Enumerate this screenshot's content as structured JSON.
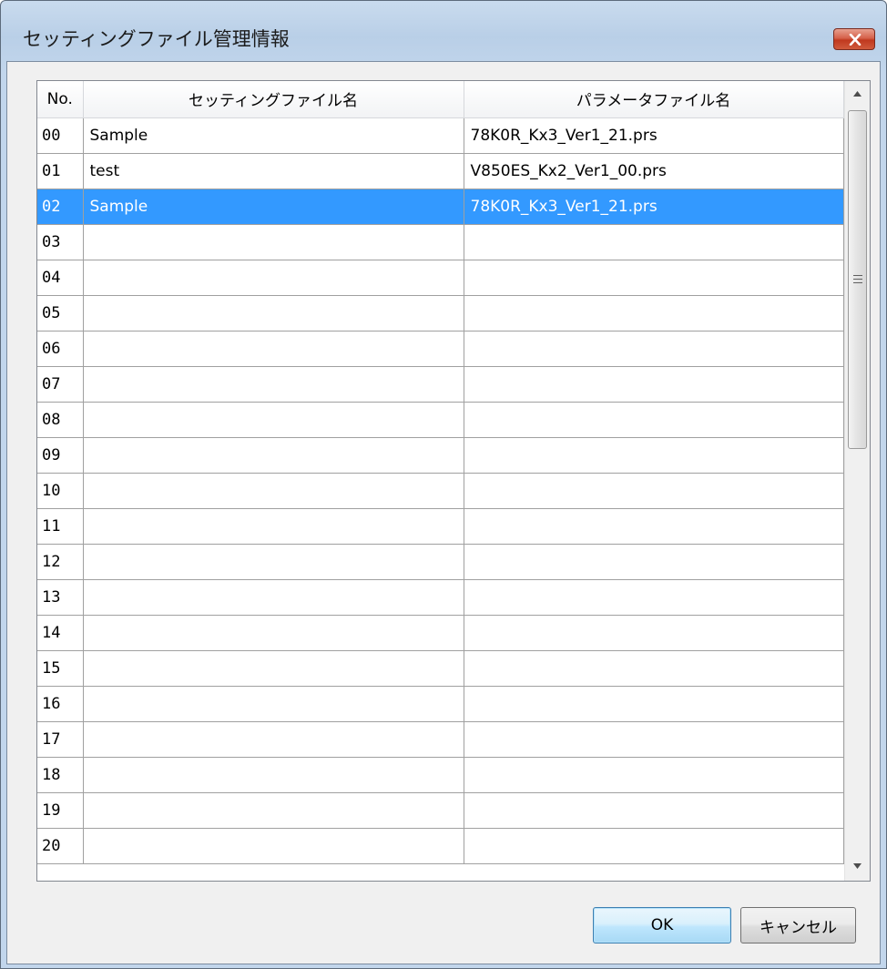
{
  "window": {
    "title": "セッティングファイル管理情報"
  },
  "table": {
    "headers": {
      "no": "No.",
      "setting_file": "セッティングファイル名",
      "param_file": "パラメータファイル名"
    },
    "rows": [
      {
        "no": "00",
        "setting": "Sample",
        "param": "78K0R_Kx3_Ver1_21.prs",
        "selected": false
      },
      {
        "no": "01",
        "setting": "test",
        "param": "V850ES_Kx2_Ver1_00.prs",
        "selected": false
      },
      {
        "no": "02",
        "setting": "Sample",
        "param": "78K0R_Kx3_Ver1_21.prs",
        "selected": true
      },
      {
        "no": "03",
        "setting": "",
        "param": "",
        "selected": false
      },
      {
        "no": "04",
        "setting": "",
        "param": "",
        "selected": false
      },
      {
        "no": "05",
        "setting": "",
        "param": "",
        "selected": false
      },
      {
        "no": "06",
        "setting": "",
        "param": "",
        "selected": false
      },
      {
        "no": "07",
        "setting": "",
        "param": "",
        "selected": false
      },
      {
        "no": "08",
        "setting": "",
        "param": "",
        "selected": false
      },
      {
        "no": "09",
        "setting": "",
        "param": "",
        "selected": false
      },
      {
        "no": "10",
        "setting": "",
        "param": "",
        "selected": false
      },
      {
        "no": "11",
        "setting": "",
        "param": "",
        "selected": false
      },
      {
        "no": "12",
        "setting": "",
        "param": "",
        "selected": false
      },
      {
        "no": "13",
        "setting": "",
        "param": "",
        "selected": false
      },
      {
        "no": "14",
        "setting": "",
        "param": "",
        "selected": false
      },
      {
        "no": "15",
        "setting": "",
        "param": "",
        "selected": false
      },
      {
        "no": "16",
        "setting": "",
        "param": "",
        "selected": false
      },
      {
        "no": "17",
        "setting": "",
        "param": "",
        "selected": false
      },
      {
        "no": "18",
        "setting": "",
        "param": "",
        "selected": false
      },
      {
        "no": "19",
        "setting": "",
        "param": "",
        "selected": false
      },
      {
        "no": "20",
        "setting": "",
        "param": "",
        "selected": false
      }
    ]
  },
  "buttons": {
    "ok": "OK",
    "cancel": "キャンセル"
  },
  "colors": {
    "selection": "#3399ff",
    "close_button": "#c7472e"
  },
  "icons": {
    "close": "close-icon",
    "scroll_up": "scroll-up-arrow-icon",
    "scroll_down": "scroll-down-arrow-icon"
  }
}
